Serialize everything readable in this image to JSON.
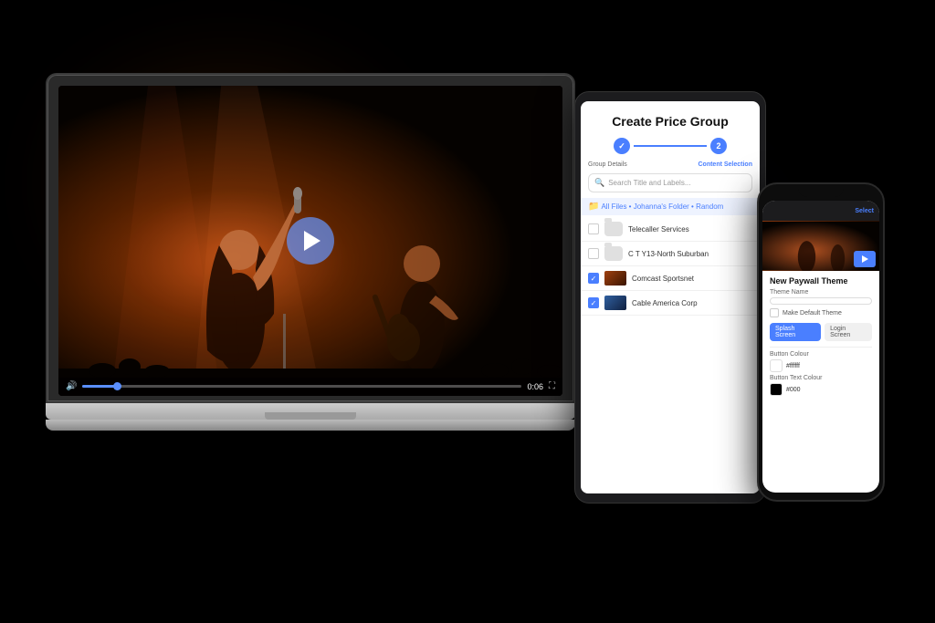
{
  "scene": {
    "background": "#000000"
  },
  "laptop": {
    "video": {
      "time_current": "0:06",
      "time_total": "0:06"
    }
  },
  "tablet": {
    "title": "Create Price Group",
    "steps": [
      {
        "label": "Group Details",
        "state": "done",
        "number": "1"
      },
      {
        "label": "Content Selection",
        "state": "active",
        "number": "2"
      }
    ],
    "search_placeholder": "Search Title and Labels...",
    "breadcrumb": "All Files • Johanna's Folder • Random",
    "files": [
      {
        "name": "Telecaller Services",
        "type": "folder",
        "checked": false
      },
      {
        "name": "C T Y13-North Suburban",
        "type": "folder",
        "checked": false
      },
      {
        "name": "Comcast Sportsnet",
        "type": "video",
        "checked": true
      },
      {
        "name": "Cable America Corp",
        "type": "video",
        "checked": true
      }
    ]
  },
  "phone": {
    "section_title": "New Paywall Theme",
    "fields": [
      {
        "label": "Theme Name",
        "value": ""
      },
      {
        "label": "Make Default Theme",
        "type": "checkbox"
      }
    ],
    "tabs": [
      {
        "label": "Splash Screen",
        "active": true
      },
      {
        "label": "Login Screen",
        "active": false
      }
    ],
    "color_fields": [
      {
        "label": "Button Colour",
        "value": "#ffffff",
        "swatch": "#ffffff"
      },
      {
        "label": "Button Text Colour",
        "value": "#000",
        "swatch": "#000000"
      }
    ]
  }
}
